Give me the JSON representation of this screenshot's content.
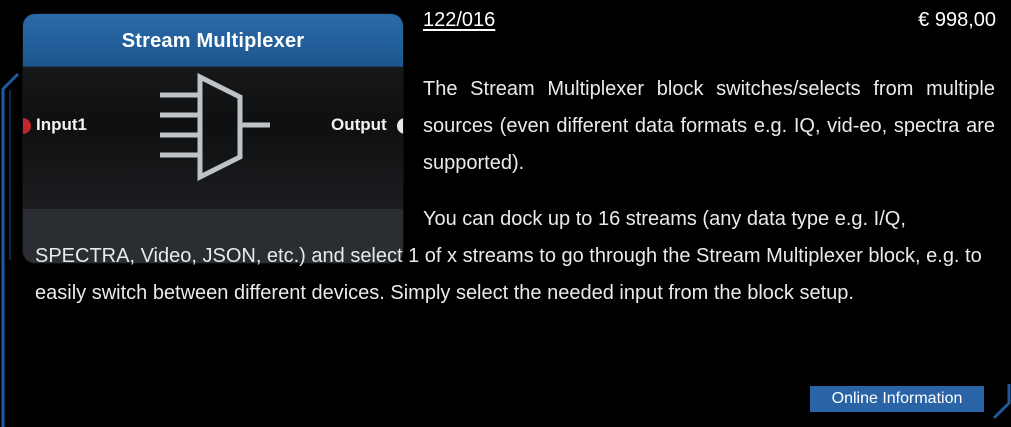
{
  "node": {
    "title": "Stream Multiplexer",
    "input_label": "Input1",
    "output_label": "Output",
    "input_color": "#c0262b",
    "output_color": "#e8e8e8",
    "header_color": "#2566a3"
  },
  "product": {
    "part_number": "122/016",
    "price": "€ 998,00"
  },
  "description": {
    "line1": "The Stream Multiplexer block switches/selects from multiple sources (even different data formats e.g. IQ, vid-eo, spectra are supported).",
    "line2_start": "You can dock up to 16 streams (any data type e.g. I/Q,",
    "line2_rest": "SPECTRA, Video, JSON, etc.) and select 1 of x streams to go through the Stream Multiplexer block, e.g. to easily switch between different devices. Simply select the needed input from the block setup."
  },
  "actions": {
    "online_info_label": "Online Information"
  },
  "colors": {
    "accent": "#2b64a6",
    "background": "#000000",
    "frame": "#1f5a9e"
  }
}
